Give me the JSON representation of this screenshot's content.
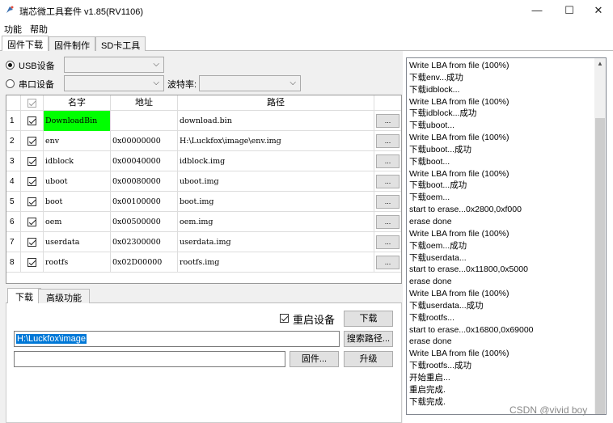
{
  "window": {
    "title": "瑞芯微工具套件 v1.85(RV1106)",
    "controls": {
      "minimize": "—",
      "maximize": "☐",
      "close": "✕"
    }
  },
  "menu": [
    "功能",
    "帮助"
  ],
  "main_tabs": [
    "固件下载",
    "固件制作",
    "SD卡工具"
  ],
  "connection": {
    "usb_label": "USB设备",
    "usb_selected": true,
    "serial_label": "串口设备",
    "serial_selected": false,
    "baud_label": "波特率:"
  },
  "table": {
    "headers": [
      "名字",
      "地址",
      "路径"
    ],
    "rows": [
      {
        "num": "1",
        "checked": true,
        "name": "DownloadBin",
        "addr": "",
        "path": "download.bin",
        "highlight": true
      },
      {
        "num": "2",
        "checked": true,
        "name": "env",
        "addr": "0x00000000",
        "path": "H:\\Luckfox\\image\\env.img",
        "highlight": false
      },
      {
        "num": "3",
        "checked": true,
        "name": "idblock",
        "addr": "0x00040000",
        "path": "idblock.img",
        "highlight": false
      },
      {
        "num": "4",
        "checked": true,
        "name": "uboot",
        "addr": "0x00080000",
        "path": "uboot.img",
        "highlight": false
      },
      {
        "num": "5",
        "checked": true,
        "name": "boot",
        "addr": "0x00100000",
        "path": "boot.img",
        "highlight": false
      },
      {
        "num": "6",
        "checked": true,
        "name": "oem",
        "addr": "0x00500000",
        "path": "oem.img",
        "highlight": false
      },
      {
        "num": "7",
        "checked": true,
        "name": "userdata",
        "addr": "0x02300000",
        "path": "userdata.img",
        "highlight": false
      },
      {
        "num": "8",
        "checked": true,
        "name": "rootfs",
        "addr": "0x02D00000",
        "path": "rootfs.img",
        "highlight": false
      }
    ],
    "browse_label": "..."
  },
  "sub_tabs": [
    "下载",
    "高级功能"
  ],
  "download": {
    "reboot_label": "重启设备",
    "reboot_checked": true,
    "download_button": "下载",
    "path_value": "H:\\Luckfox\\image",
    "search_path_button": "搜索路径...",
    "firmware_value": "",
    "firmware_button": "固件...",
    "upgrade_button": "升级"
  },
  "log": [
    "Write LBA from file (100%)",
    "下载env...成功",
    "下载idblock...",
    "Write LBA from file (100%)",
    "下载idblock...成功",
    "下载uboot...",
    "Write LBA from file (100%)",
    "下载uboot...成功",
    "下载boot...",
    "Write LBA from file (100%)",
    "下载boot...成功",
    "下载oem...",
    "start to erase...0x2800,0xf000",
    "erase done",
    "Write LBA from file (100%)",
    "下载oem...成功",
    "下载userdata...",
    "start to erase...0x11800,0x5000",
    "erase done",
    "Write LBA from file (100%)",
    "下载userdata...成功",
    "下载rootfs...",
    "start to erase...0x16800,0x69000",
    "erase done",
    "Write LBA from file (100%)",
    "下载rootfs...成功",
    "开始重启...",
    "重启完成.",
    "下载完成."
  ],
  "watermark": "CSDN @vivid boy",
  "colors": {
    "highlight_green": "#00ff00",
    "selection_blue": "#0078d7"
  }
}
